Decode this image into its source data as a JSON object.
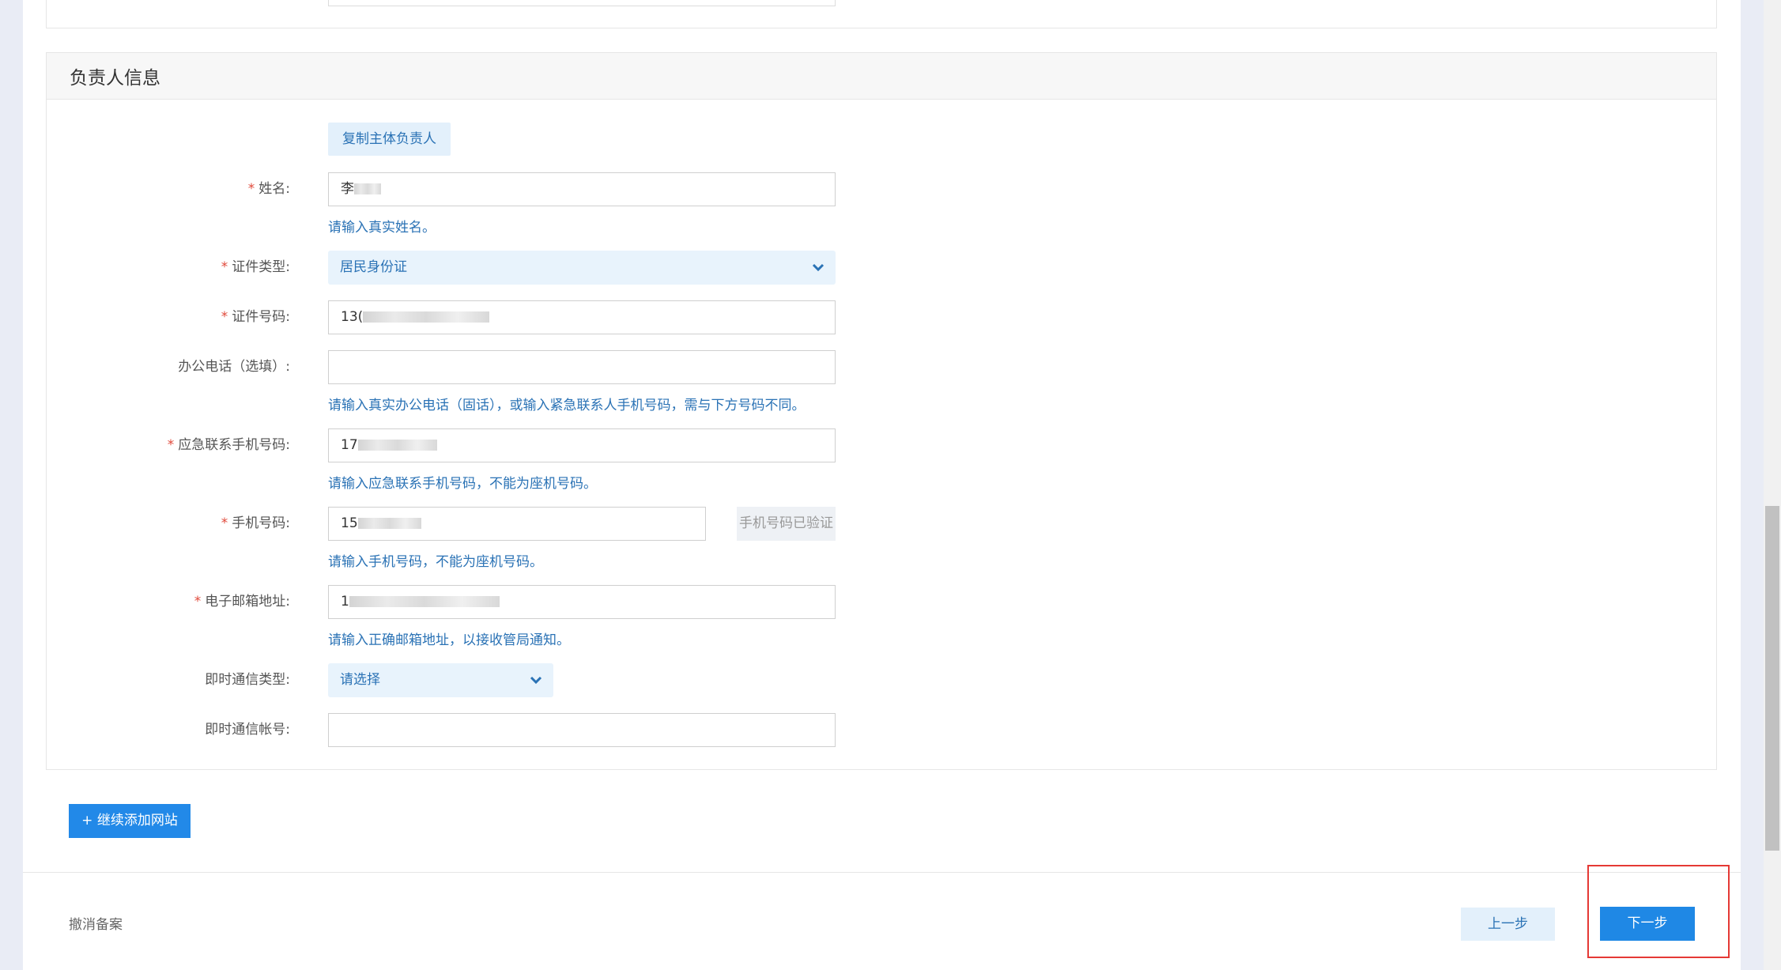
{
  "section": {
    "title": "负责人信息"
  },
  "copy_button": "复制主体负责人",
  "fields": {
    "name": {
      "label": "姓名:",
      "value": "李",
      "hint": "请输入真实姓名。"
    },
    "id_type": {
      "label": "证件类型:",
      "value": "居民身份证"
    },
    "id_number": {
      "label": "证件号码:",
      "value": "13("
    },
    "office_phone": {
      "label": "办公电话（选填）:",
      "value": "",
      "hint": "请输入真实办公电话（固话），或输入紧急联系人手机号码，需与下方号码不同。"
    },
    "emergency_phone": {
      "label": "应急联系手机号码:",
      "value": "17",
      "hint": "请输入应急联系手机号码，不能为座机号码。"
    },
    "mobile": {
      "label": "手机号码:",
      "value": "15",
      "verify_label": "手机号码已验证",
      "hint": "请输入手机号码，不能为座机号码。"
    },
    "email": {
      "label": "电子邮箱地址:",
      "value": "1",
      "hint": "请输入正确邮箱地址，以接收管局通知。"
    },
    "im_type": {
      "label": "即时通信类型:",
      "value": "请选择"
    },
    "im_account": {
      "label": "即时通信帐号:",
      "value": ""
    }
  },
  "actions": {
    "add_site": "+ 继续添加网站",
    "cancel": "撤消备案",
    "prev": "上一步",
    "next": "下一步"
  },
  "colors": {
    "primary": "#1f88e5",
    "link": "#2a72b5",
    "required": "#e0493b",
    "highlight": "#e53935"
  }
}
